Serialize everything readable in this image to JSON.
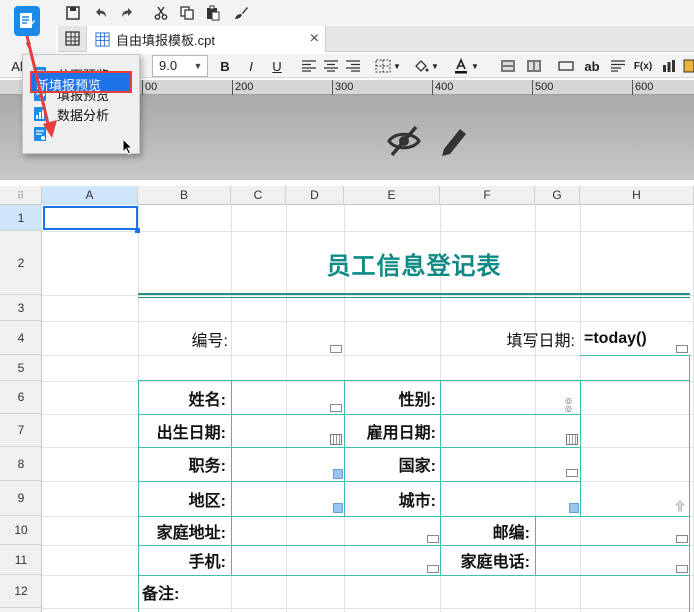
{
  "toolbar": {
    "icons": [
      "save-icon",
      "undo-icon",
      "redo-icon",
      "cut-icon",
      "copy-icon",
      "paste-icon",
      "format-brush-icon"
    ]
  },
  "tab": {
    "file_name": "自由填报模板.cpt",
    "close": "×"
  },
  "format_bar": {
    "font_name_partial": "Al",
    "font_size": "9.0",
    "bold": "B",
    "italic": "I",
    "underline": "U",
    "text_btn": "ab",
    "fx": "F(x)"
  },
  "preview_menu": {
    "items": [
      {
        "label": "分页预览"
      },
      {
        "label": "填报预览"
      },
      {
        "label": "数据分析"
      },
      {
        "label": "新填报预览"
      }
    ]
  },
  "ruler": {
    "ticks": [
      "00",
      "200",
      "300",
      "400",
      "500",
      "600"
    ]
  },
  "columns": [
    "A",
    "B",
    "C",
    "D",
    "E",
    "F",
    "G",
    "H"
  ],
  "rows": [
    "1",
    "2",
    "3",
    "4",
    "5",
    "6",
    "7",
    "8",
    "9",
    "10",
    "11",
    "12"
  ],
  "form": {
    "title": "员工信息登记表",
    "number_label": "编号:",
    "fill_date_label": "填写日期:",
    "fill_date_formula": "=today()",
    "name_label": "姓名:",
    "gender_label": "性别:",
    "birth_label": "出生日期:",
    "hire_label": "雇用日期:",
    "position_label": "职务:",
    "country_label": "国家:",
    "region_label": "地区:",
    "city_label": "城市:",
    "address_label": "家庭地址:",
    "postcode_label": "邮编:",
    "mobile_label": "手机:",
    "home_phone_label": "家庭电话:",
    "remark_label": "备注:"
  },
  "colors": {
    "accent": "#1c8ae8",
    "teal_title": "#0f8a84",
    "table_border": "#3fbdb2",
    "highlight_border": "#e63d3d"
  }
}
